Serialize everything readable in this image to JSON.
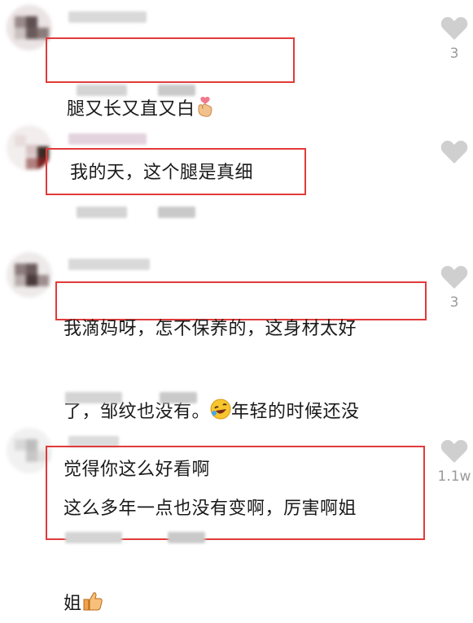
{
  "comments": [
    {
      "text": "腿又长又直又白",
      "like_count": "3",
      "emoji": "finger-heart"
    },
    {
      "text": "我的天，这个腿是真细",
      "like_count": "",
      "emoji": ""
    },
    {
      "text_line1": "我滴妈呀，怎不保养的，这身材太好",
      "text_line2a": "了，邹纹也没有。",
      "text_line2b": "年轻的时候还没",
      "text_line3": "觉得你这么好看啊",
      "like_count": "3",
      "emoji": "rofl-face"
    },
    {
      "text_line1": "这么多年一点也没有变啊，厉害啊姐",
      "text_line2": "姐",
      "like_count": "1.1w",
      "emoji": "thumbs-up"
    }
  ],
  "colors": {
    "highlight_box": "#e23a3a",
    "like_icon": "#cfcfcf",
    "count_text": "#9a9a9a"
  }
}
